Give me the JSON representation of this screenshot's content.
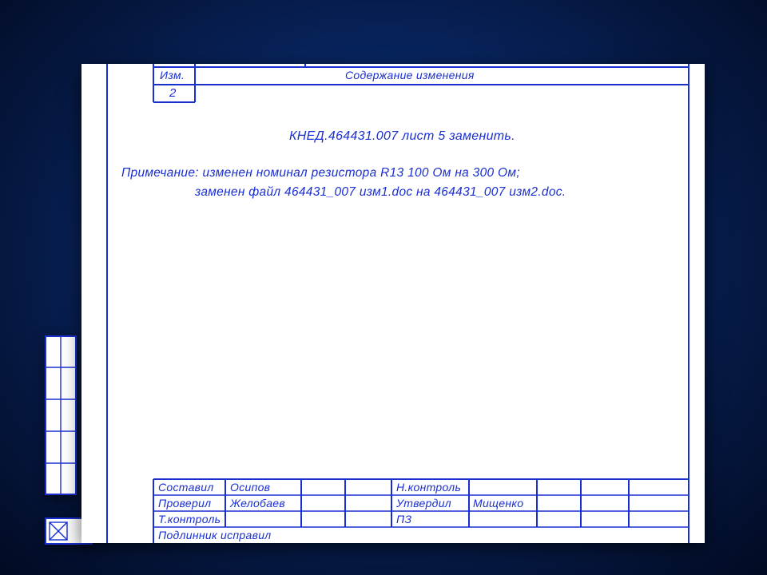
{
  "header": {
    "col_change": "Изм.",
    "col_content": "Содержание изменения",
    "change_number": "2"
  },
  "body": {
    "title_line": "КНЕД.464431.007 лист 5 заменить.",
    "note_line1": "Примечание: изменен номинал резистора R13 100 Ом на 300 Ом;",
    "note_line2": "заменен файл 464431_007 изм1.doc на 464431_007 изм2.doc."
  },
  "footer": {
    "rows": [
      {
        "role": "Составил",
        "name": "Осипов",
        "role2": "Н.контроль",
        "name2": ""
      },
      {
        "role": "Проверил",
        "name": "Желобаев",
        "role2": "Утвердил",
        "name2": "Мищенко"
      },
      {
        "role": "Т.контроль",
        "name": "",
        "role2": "ПЗ",
        "name2": ""
      }
    ],
    "bottom_line": "Подлинник исправил"
  },
  "colors": {
    "ink": "#1a2fd1",
    "paper": "#ffffff",
    "bg_center": "#0e3a8a",
    "bg_edge": "#020a22"
  }
}
